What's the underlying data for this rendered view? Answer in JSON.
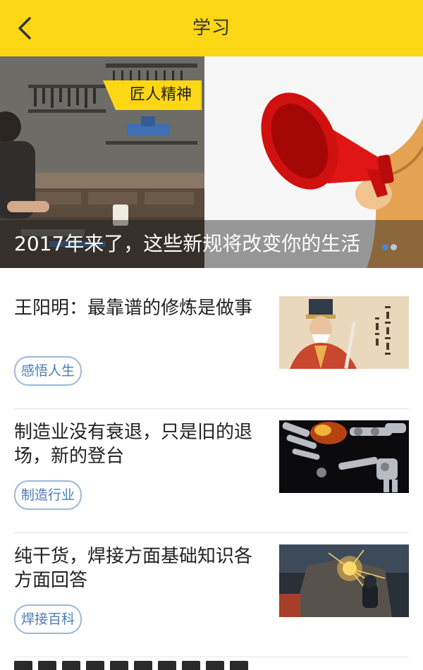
{
  "header": {
    "title": "学习",
    "back_icon": "chevron-left-icon",
    "background": "#fcd716"
  },
  "banner": {
    "slides": [
      {
        "tag": "匠人精神",
        "image": "craftsman-workshop-photo"
      },
      {
        "image": "red-megaphone-cartoon"
      }
    ],
    "caption": "2017年来了，这些新规将改变你的生活",
    "dots": 2,
    "active_dot": 0
  },
  "articles": [
    {
      "title": "王阳明：最靠谱的修炼是做事",
      "tag": "感悟人生",
      "thumb": "wang-yangming-painting"
    },
    {
      "title": "制造业没有衰退，只是旧的退场，新的登台",
      "tag": "制造行业",
      "thumb": "robotic-hands-image"
    },
    {
      "title": "纯干货，焊接方面基础知识各方面回答",
      "tag": "焊接百科",
      "thumb": "welding-sparks-photo"
    }
  ],
  "colors": {
    "accent": "#fcd716",
    "tag_text": "#4a7cb5",
    "tag_border": "#9db8d8",
    "divider": "#e4e4e4"
  }
}
